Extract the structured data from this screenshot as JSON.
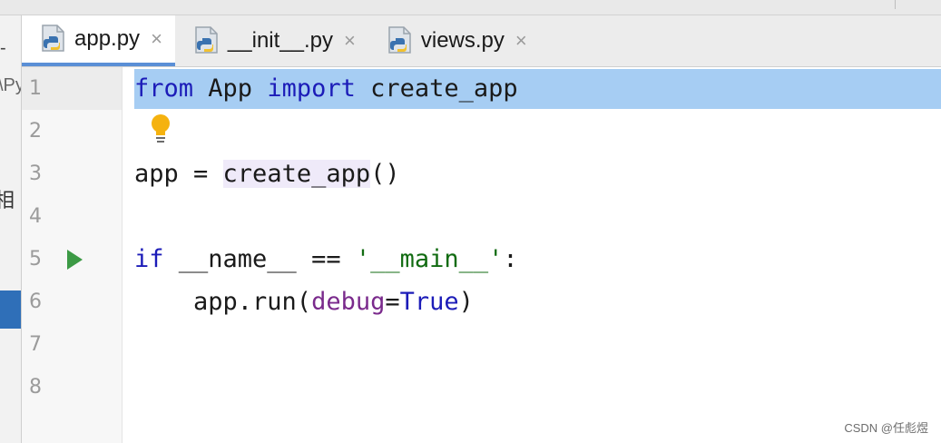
{
  "tabs": [
    {
      "label": "app.py",
      "active": true,
      "icon": "python-file-icon",
      "close": "×"
    },
    {
      "label": "__init__.py",
      "active": false,
      "icon": "python-file-icon",
      "close": "×"
    },
    {
      "label": "views.py",
      "active": false,
      "icon": "python-file-icon",
      "close": "×"
    }
  ],
  "editor": {
    "line_numbers": [
      "1",
      "2",
      "3",
      "4",
      "5",
      "6",
      "7",
      "8"
    ],
    "lines": {
      "l1": {
        "kw1": "from",
        "mod": " App ",
        "kw2": "import",
        "name": " create_app"
      },
      "l3": {
        "var": "app = ",
        "call": "create_app",
        "paren": "()"
      },
      "l5": {
        "kw": "if",
        "cond": " __name__ == ",
        "str": "'__main__'",
        "colon": ":"
      },
      "l6": {
        "pre": "    app.run(",
        "param": "debug",
        "eq": "=",
        "val": "True",
        "close": ")"
      }
    },
    "highlighted_line": 1,
    "intention_icon": "lightbulb-icon",
    "run_marker_line": 5,
    "colors": {
      "keyword": "#1c1cb8",
      "string": "#116b11",
      "parameter": "#7a2a8c",
      "selection": "#a6cdf3",
      "run": "#3c9a45",
      "bulb": "#f5b20f"
    }
  },
  "left_panel": {
    "fragment_1": "-",
    "fragment_2": "\\Py",
    "fragment_3": "相"
  },
  "watermark": "CSDN @任彪煜"
}
